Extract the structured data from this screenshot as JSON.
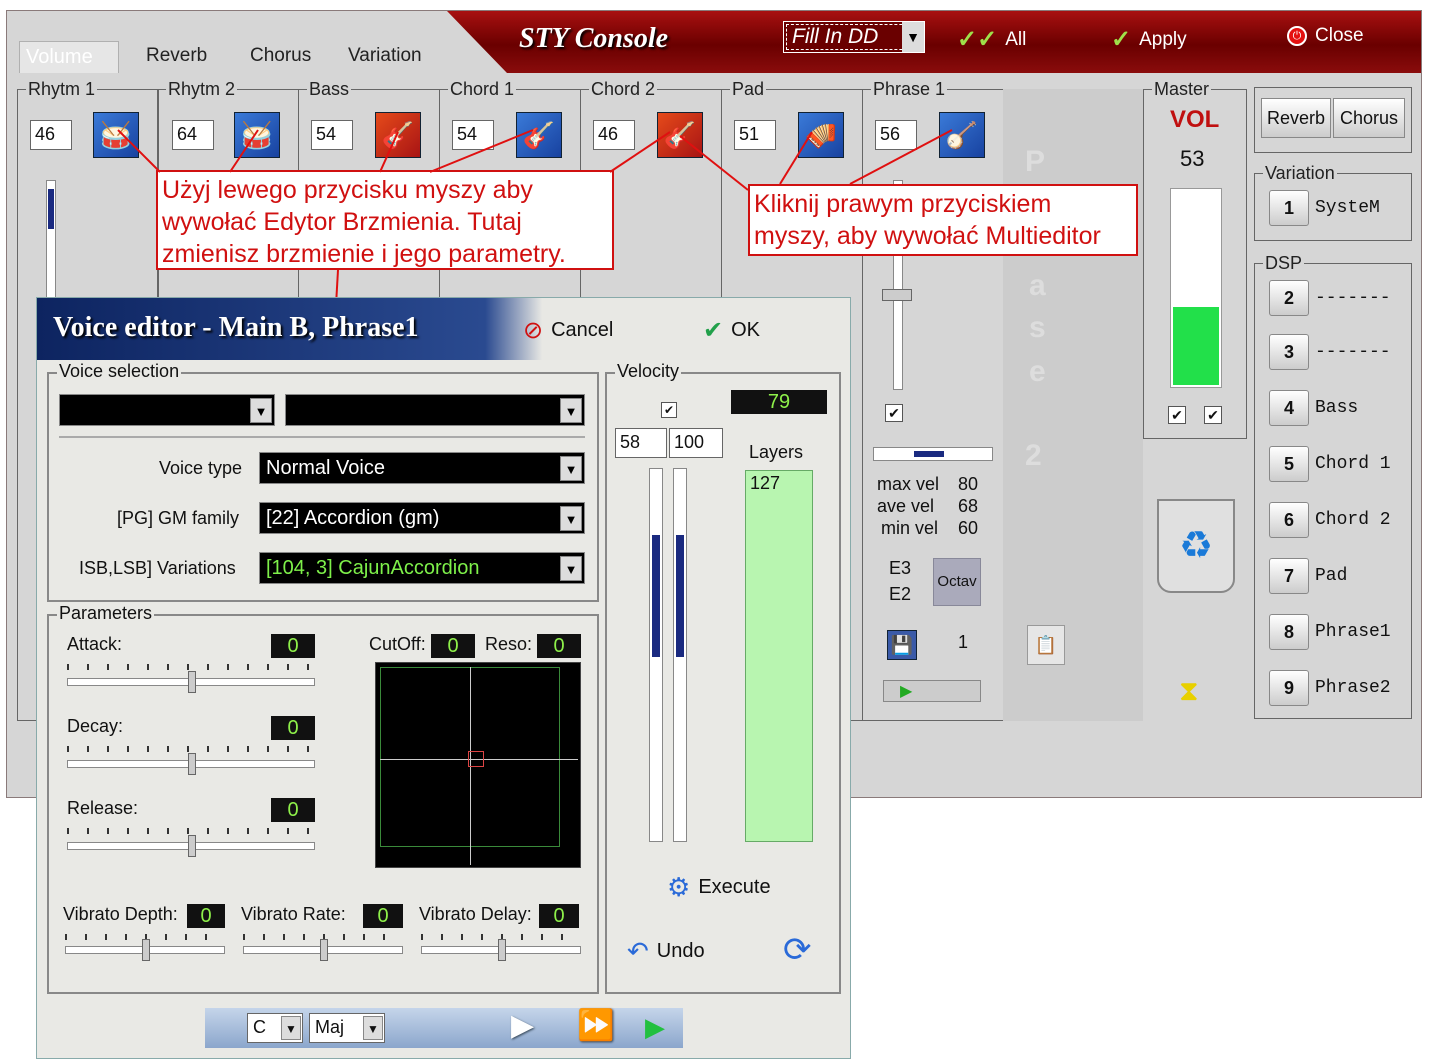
{
  "console": {
    "title": "STY Console",
    "tabs": [
      "Volume",
      "Reverb",
      "Chorus",
      "Variation"
    ],
    "fill_select": "Fill In DD",
    "all_label": "All",
    "apply_label": "Apply",
    "close_label": "Close"
  },
  "channels": [
    {
      "label": "Rhytm 1",
      "value": "46",
      "icon": "drum-kit-icon"
    },
    {
      "label": "Rhytm 2",
      "value": "64",
      "icon": "drum-kit-icon"
    },
    {
      "label": "Bass",
      "value": "54",
      "icon": "bass-icon"
    },
    {
      "label": "Chord 1",
      "value": "54",
      "icon": "guitar-icon"
    },
    {
      "label": "Chord 2",
      "value": "46",
      "icon": "electric-guitar-icon"
    },
    {
      "label": "Pad",
      "value": "51",
      "icon": "accordion-icon"
    },
    {
      "label": "Phrase 1",
      "value": "56",
      "icon": "banjo-icon"
    }
  ],
  "annotations": {
    "left": "Użyj lewego przycisku myszy aby wywołać Edytor Brzmienia. Tutaj zmienisz brzmienie i jego parametry.",
    "right": "Kliknij prawym przyciskiem myszy, aby wywołać Multieditor"
  },
  "phrase_panel": {
    "max_vel_label": "max vel",
    "max_vel": "80",
    "ave_vel_label": "ave vel",
    "ave_vel": "68",
    "min_vel_label": "min vel",
    "min_vel": "60",
    "note_high": "E3",
    "note_low": "E2",
    "octav_label": "Octav",
    "counter": "1"
  },
  "phase_watermark": [
    "P",
    "a",
    "s",
    "e",
    "2"
  ],
  "master": {
    "label": "Master",
    "vol_label": "VOL",
    "vol_value": "53",
    "level": 0.4
  },
  "right_panel": {
    "reverb_label": "Reverb",
    "chorus_label": "Chorus",
    "variation_label": "Variation",
    "variation_items": [
      {
        "num": "1",
        "name": "SysteM"
      }
    ],
    "dsp_label": "DSP",
    "dsp_items": [
      {
        "num": "2",
        "name": "-------"
      },
      {
        "num": "3",
        "name": "-------"
      },
      {
        "num": "4",
        "name": "Bass"
      },
      {
        "num": "5",
        "name": "Chord 1"
      },
      {
        "num": "6",
        "name": "Chord 2"
      },
      {
        "num": "7",
        "name": "Pad"
      },
      {
        "num": "8",
        "name": "Phrase1"
      },
      {
        "num": "9",
        "name": "Phrase2"
      }
    ]
  },
  "editor": {
    "title": "Voice editor - Main B, Phrase1",
    "cancel_label": "Cancel",
    "ok_label": "OK",
    "voice_selection_label": "Voice selection",
    "voice_type_label": "Voice type",
    "voice_type_value": "Normal Voice",
    "gm_family_label": "[PG] GM family",
    "gm_family_value": "[22] Accordion (gm)",
    "variations_label": "ISB,LSB] Variations",
    "variations_value": "[104, 3] CajunAccordion",
    "parameters_label": "Parameters",
    "attack_label": "Attack:",
    "attack_value": "0",
    "decay_label": "Decay:",
    "decay_value": "0",
    "release_label": "Release:",
    "release_value": "0",
    "cutoff_label": "CutOff:",
    "cutoff_value": "0",
    "reso_label": "Reso:",
    "reso_value": "0",
    "vib_depth_label": "Vibrato Depth:",
    "vib_depth_value": "0",
    "vib_rate_label": "Vibrato Rate:",
    "vib_rate_value": "0",
    "vib_delay_label": "Vibrato Delay:",
    "vib_delay_value": "0",
    "velocity_label": "Velocity",
    "velocity_value": "79",
    "vel_low": "58",
    "vel_high": "100",
    "layers_label": "Layers",
    "layers_value": "127",
    "execute_label": "Execute",
    "undo_label": "Undo",
    "key_value": "C",
    "scale_value": "Maj"
  }
}
